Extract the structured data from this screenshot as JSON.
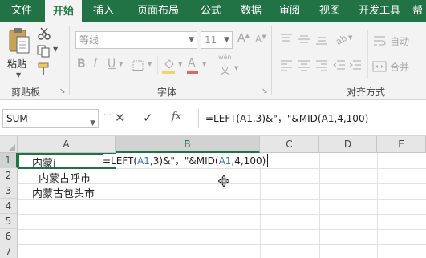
{
  "ribbon_tabs": [
    "文件",
    "开始",
    "插入",
    "页面布局",
    "公式",
    "数据",
    "审阅",
    "视图",
    "开发工具",
    "帮"
  ],
  "clipboard": {
    "paste_label": "粘贴",
    "group_label": "剪贴板"
  },
  "font": {
    "name_value": "等线",
    "size_value": "11",
    "group_label": "字体",
    "wen_label": "wén",
    "wen_char": "文"
  },
  "alignment": {
    "autowrap_label": "自动",
    "merge_label": "合并",
    "group_label": "对齐方式"
  },
  "formula_bar": {
    "name_box": "SUM",
    "cancel_symbol": "✕",
    "enter_symbol": "✓",
    "fx_symbol": "fx",
    "formula": "=LEFT(A1,3)&\"，\"&MID(A1,4,100)"
  },
  "grid": {
    "columns": [
      "A",
      "B",
      "C",
      "D",
      "E"
    ],
    "rows": [
      "1",
      "2",
      "3",
      "4",
      "5",
      "6",
      "7"
    ],
    "selected_column": "B",
    "selected_row": "1",
    "cells": {
      "a1": "内蒙i",
      "a2": "内蒙古呼市",
      "a3": "内蒙古包头市"
    },
    "edit": {
      "p1": "=LEFT(",
      "r1": "A1",
      "p2": ",3)&\"，\"&MID(",
      "r2": "A1",
      "p3": ",4,100)"
    }
  },
  "colors": {
    "brand_green": "#217346",
    "reference_blue": "#4472c4"
  }
}
